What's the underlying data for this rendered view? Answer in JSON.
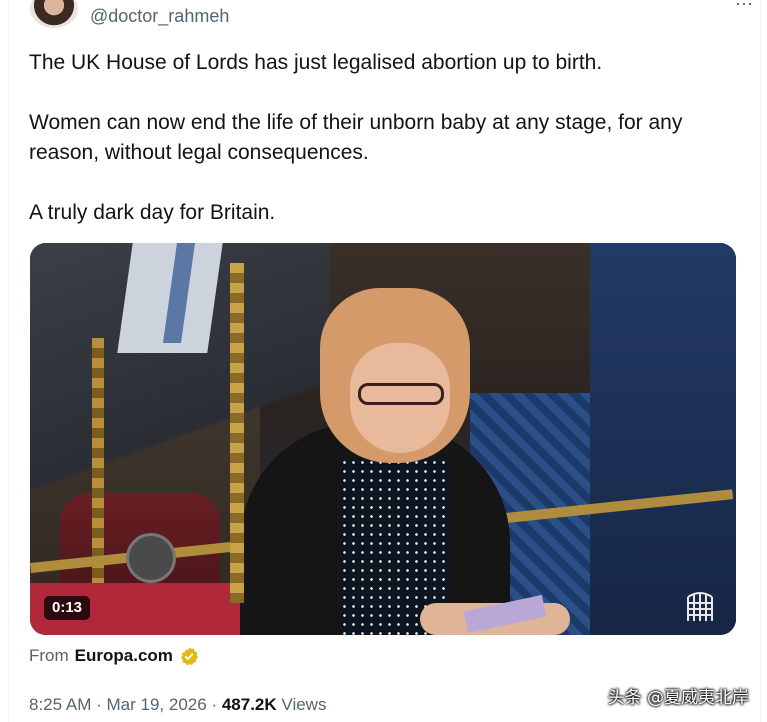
{
  "author": {
    "handle": "@doctor_rahmeh"
  },
  "tweet": {
    "paragraphs": [
      "The UK House of Lords has just legalised abortion up to birth.",
      "Women can now end the life of their unborn baby at any stage, for any reason, without legal consequences.",
      "A truly dark day for Britain."
    ]
  },
  "media": {
    "duration": "0:13",
    "icon": "portcullis-icon"
  },
  "source": {
    "prefix": "From",
    "name": "Europa.com",
    "icon": "gold-verified-badge-icon"
  },
  "meta": {
    "time": "8:25 AM",
    "sep1": "·",
    "date": "Mar 19, 2026",
    "sep2": "·",
    "views_count": "487.2K",
    "views_label": "Views"
  },
  "watermark": "头条 @夏威夷北岸",
  "colors": {
    "text": "#0f1419",
    "secondary": "#536471",
    "verified_gold": "#e2b719"
  }
}
